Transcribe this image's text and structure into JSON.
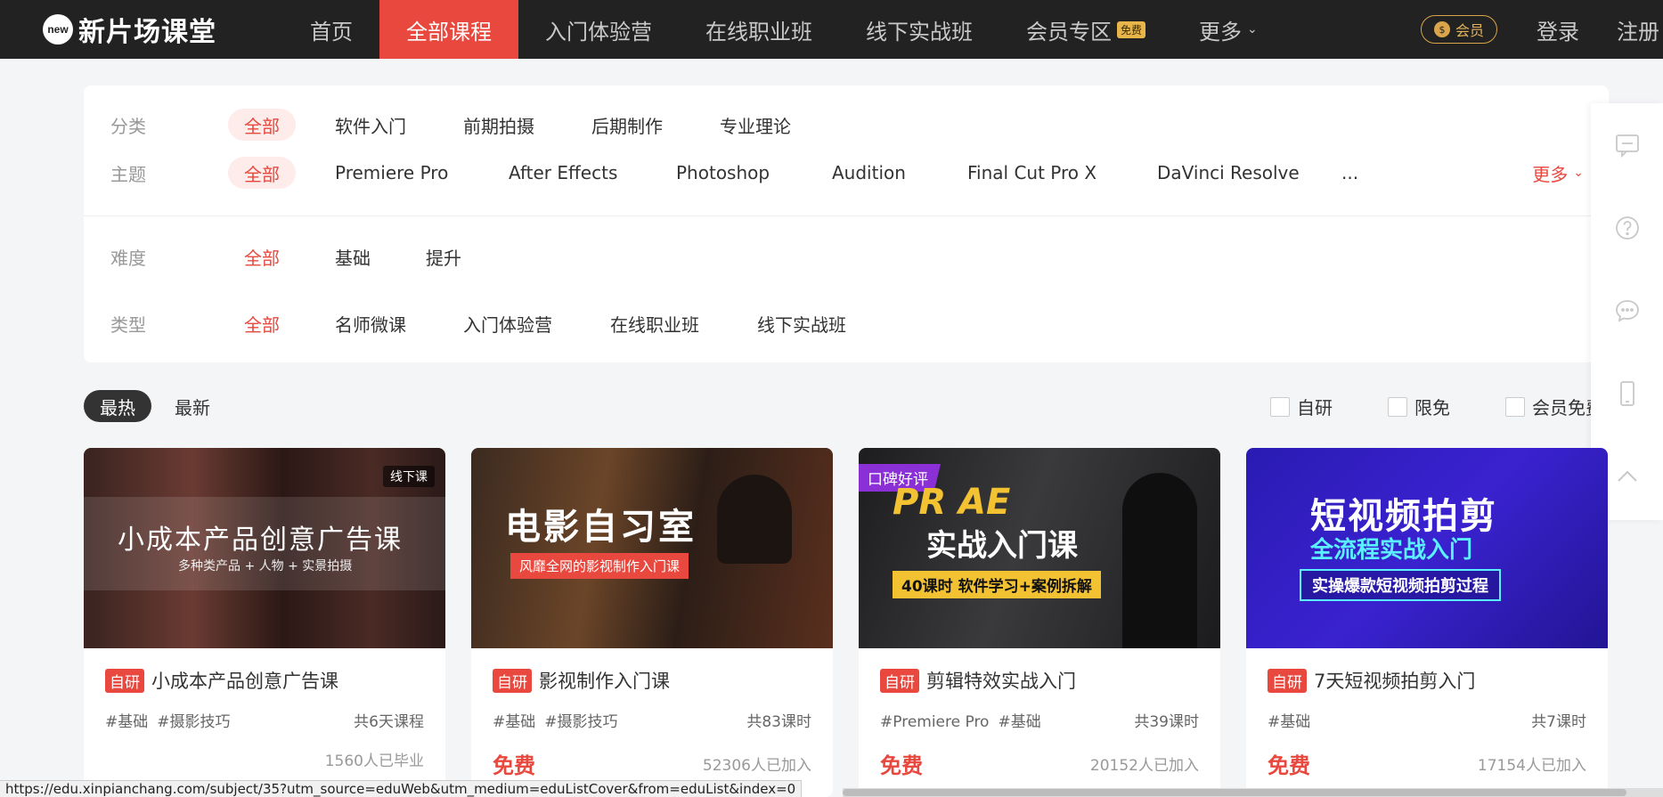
{
  "brand": {
    "badge": "new",
    "name": "新片场课堂"
  },
  "nav": {
    "items": [
      {
        "label": "首页"
      },
      {
        "label": "全部课程"
      },
      {
        "label": "入门体验营"
      },
      {
        "label": "在线职业班"
      },
      {
        "label": "线下实战班"
      },
      {
        "label": "会员专区",
        "tag": "免费"
      },
      {
        "label": "更多"
      }
    ],
    "active_index": 1,
    "vip": "会员",
    "vip_icon": "$",
    "login": "登录",
    "register": "注册"
  },
  "filters": {
    "category": {
      "label": "分类",
      "options": [
        "全部",
        "软件入门",
        "前期拍摄",
        "后期制作",
        "专业理论"
      ]
    },
    "topic": {
      "label": "主题",
      "options": [
        "全部",
        "Premiere Pro",
        "After Effects",
        "Photoshop",
        "Audition",
        "Final Cut Pro X",
        "DaVinci Resolve",
        "..."
      ],
      "more": "更多"
    },
    "difficulty": {
      "label": "难度",
      "options": [
        "全部",
        "基础",
        "提升"
      ]
    },
    "type": {
      "label": "类型",
      "options": [
        "全部",
        "名师微课",
        "入门体验营",
        "在线职业班",
        "线下实战班"
      ]
    }
  },
  "sort": {
    "hot": "最热",
    "new": "最新",
    "active": "hot"
  },
  "checks": {
    "self": "自研",
    "limited": "限免",
    "vip_free": "会员免费"
  },
  "cards": [
    {
      "cover_title": "小成本产品创意广告课",
      "cover_sub": "多种类产品 + 人物 + 实景拍摄",
      "corner": "线下课",
      "self_tag": "自研",
      "title": "小成本产品创意广告课",
      "tags": [
        "#基础",
        "#摄影技巧"
      ],
      "lessons": "共6天课程",
      "price": "",
      "count": "1560人已毕业"
    },
    {
      "cover_title": "电影自习室",
      "cover_sub": "风靡全网的影视制作入门课",
      "self_tag": "自研",
      "title": "影视制作入门课",
      "tags": [
        "#基础",
        "#摄影技巧"
      ],
      "lessons": "共83课时",
      "price": "免费",
      "count": "52306人已加入"
    },
    {
      "praise": "口碑好评",
      "cover_title": "PR AE",
      "cover_title2": "实战入门课",
      "cover_sub": "40课时 软件学习+案例拆解",
      "self_tag": "自研",
      "title": "剪辑特效实战入门",
      "tags": [
        "#Premiere Pro",
        "#基础"
      ],
      "lessons": "共39课时",
      "price": "免费",
      "count": "20152人已加入"
    },
    {
      "cover_title": "短视频拍剪",
      "cover_title2": "全流程实战入门",
      "cover_sub": "实操爆款短视频拍剪过程",
      "self_tag": "自研",
      "title": "7天短视频拍剪入门",
      "tags": [
        "#基础"
      ],
      "lessons": "共7课时",
      "price": "免费",
      "count": "17154人已加入"
    }
  ],
  "status_url": "https://edu.xinpianchang.com/subject/35?utm_source=eduWeb&utm_medium=eduListCover&from=eduList&index=0",
  "colors": {
    "accent": "#e8483e",
    "nav_bg": "#222222",
    "vip_gold": "#d9a44a"
  }
}
